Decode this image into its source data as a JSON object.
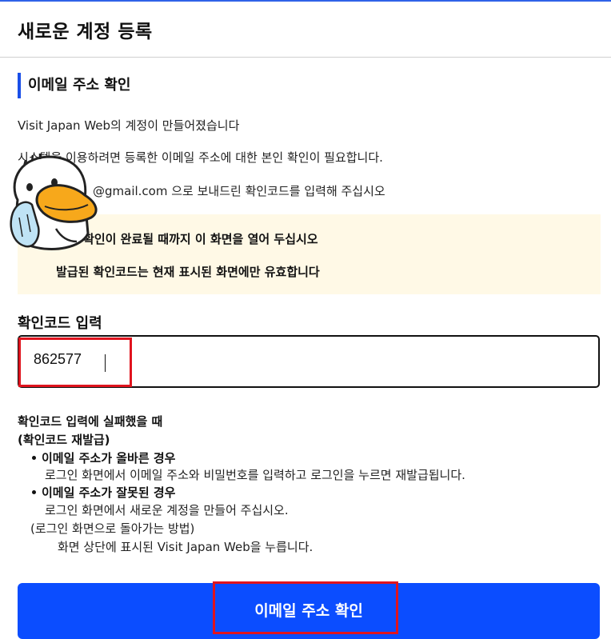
{
  "header": {
    "title": "새로운 계정 등록"
  },
  "section": {
    "title": "이메일 주소 확인"
  },
  "info": {
    "line1": "Visit Japan Web의 계정이 만들어졌습니다",
    "line2": "시스템을 이용하려면 등록한 이메일 주소에 대한 본인 확인이 필요합니다.",
    "line3": "@gmail.com 으로 보내드린 확인코드를 입력해 주십시오"
  },
  "notice": {
    "line1": "! 확인이 완료될 때까지 이 화면을 열어 두십시오",
    "line2": "발급된 확인코드는 현재 표시된 화면에만 유효합니다"
  },
  "code_field": {
    "label": "확인코드 입력",
    "value": "862577"
  },
  "help": {
    "heading": "확인코드 입력에 실패했을 때",
    "subheading": "(확인코드 재발급)",
    "case1_title": "이메일 주소가 올바른 경우",
    "case1_text": "로그인 화면에서 이메일 주소와 비밀번호를 입력하고 로그인을 누르면 재발급됩니다.",
    "case2_title": "이메일 주소가 잘못된 경우",
    "case2_text": "로그인 화면에서 새로운 계정을 만들어 주십시오.",
    "howto_title": "(로그인 화면으로 돌아가는 방법)",
    "howto_text": "화면 상단에 표시된 Visit Japan Web을 누릅니다."
  },
  "confirm_button": {
    "label": "이메일 주소 확인",
    "color": "#0b4dff"
  },
  "colors": {
    "accent": "#1a4fe8",
    "highlight": "#e0141e",
    "notice_bg": "#fff9e6"
  },
  "overlay": {
    "sticker_icon": "duck-character-sticker"
  }
}
